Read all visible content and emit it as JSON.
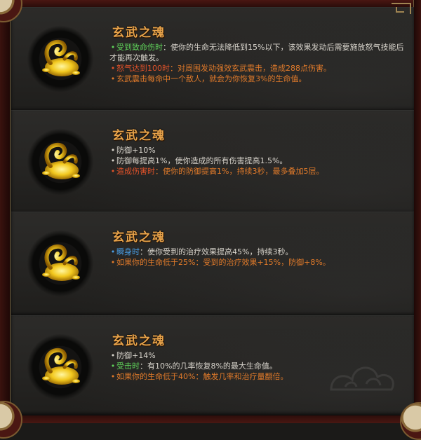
{
  "colors": {
    "title": "#e8a34a",
    "text": "#d8d4cc",
    "green": "#5fd35a",
    "red": "#e0522a",
    "orange": "#e07a2a",
    "blue": "#4aa0e8"
  },
  "cards": [
    {
      "title": "玄武之魂",
      "icon": "golden-turtle-icon",
      "lines": [
        {
          "bullet": "•",
          "segments": [
            {
              "text": "受到致命伤时",
              "color": "green"
            },
            {
              "text": "：使你的生命无法降低到15%以下，该效果发动后需要施放怒气技能后才能再次触发。",
              "color": "white"
            }
          ]
        },
        {
          "bullet": "•",
          "segments": [
            {
              "text": "怒气达到100时",
              "color": "red"
            },
            {
              "text": "：对周围发动强效玄武震击，造成288点伤害。",
              "color": "orange"
            }
          ]
        },
        {
          "bullet": "•",
          "segments": [
            {
              "text": "玄武震击每命中一个敌人，就会为你恢复3%的生命值。",
              "color": "orange"
            }
          ]
        }
      ]
    },
    {
      "title": "玄武之魂",
      "icon": "golden-turtle-icon",
      "lines": [
        {
          "bullet": "•",
          "segments": [
            {
              "text": "防御+10%",
              "color": "white"
            }
          ]
        },
        {
          "bullet": "•",
          "segments": [
            {
              "text": "防御每提高1%，使你造成的所有伤害提高1.5%。",
              "color": "white"
            }
          ]
        },
        {
          "bullet": "•",
          "segments": [
            {
              "text": "造成伤害时",
              "color": "red"
            },
            {
              "text": "：使你的防御提高1%，持续3秒，最多叠加5层。",
              "color": "orange"
            }
          ]
        }
      ]
    },
    {
      "title": "玄武之魂",
      "icon": "golden-turtle-icon",
      "lines": [
        {
          "bullet": "•",
          "segments": [
            {
              "text": "瞬身时",
              "color": "blue"
            },
            {
              "text": "：使你受到的治疗效果提高45%，持续3秒。",
              "color": "white"
            }
          ]
        },
        {
          "bullet": "•",
          "segments": [
            {
              "text": "如果你的生命低于25%：受到的治疗效果+15%，防御+8%。",
              "color": "orange"
            }
          ]
        }
      ]
    },
    {
      "title": "玄武之魂",
      "icon": "golden-turtle-icon",
      "lines": [
        {
          "bullet": "•",
          "segments": [
            {
              "text": "防御+14%",
              "color": "white"
            }
          ]
        },
        {
          "bullet": "•",
          "segments": [
            {
              "text": "受击时",
              "color": "green"
            },
            {
              "text": "：有10%的几率恢复8%的最大生命值。",
              "color": "white"
            }
          ]
        },
        {
          "bullet": "•",
          "segments": [
            {
              "text": "如果你的生命低于40%：触发几率和治疗量翻倍。",
              "color": "orange"
            }
          ]
        }
      ]
    }
  ]
}
